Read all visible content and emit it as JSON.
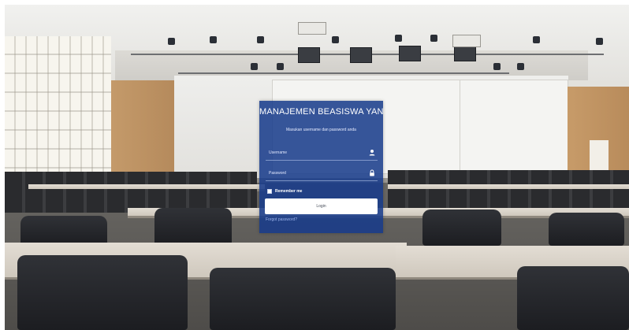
{
  "background": {
    "scene": "lecture-hall-photo"
  },
  "login": {
    "title": "MANAJEMEN BEASISWA YAN",
    "subtitle": "Masukan username dan password anda",
    "username_placeholder": "Username",
    "password_placeholder": "Password",
    "username_icon": "user-icon",
    "password_icon": "lock-icon",
    "remember_label": "Remember me",
    "remember_checked": false,
    "button_label": "Login",
    "forgot_label": "Forgot password?"
  },
  "colors": {
    "panel": "#163a8a",
    "button": "#ffffff",
    "link": "#9fb6f0"
  }
}
